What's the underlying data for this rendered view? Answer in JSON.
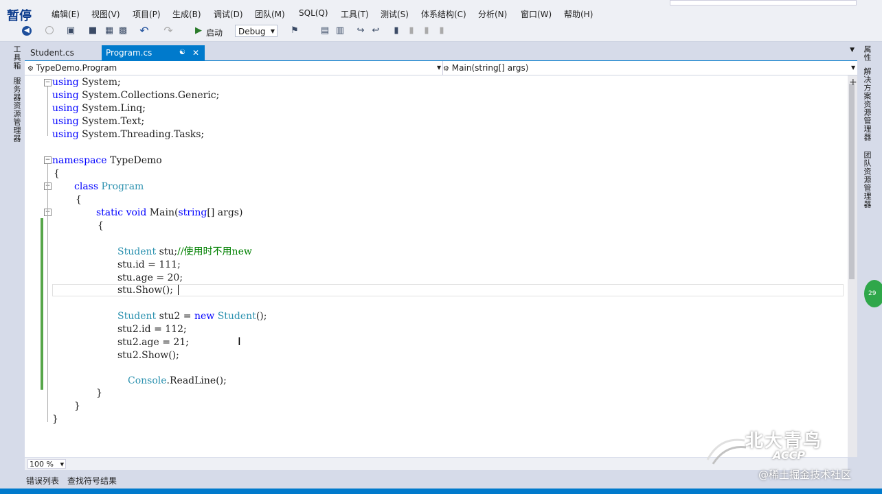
{
  "overlay": {
    "pause_text": "暂停"
  },
  "menu": [
    "编辑(E)",
    "视图(V)",
    "项目(P)",
    "生成(B)",
    "调试(D)",
    "团队(M)",
    "SQL(Q)",
    "工具(T)",
    "测试(S)",
    "体系结构(C)",
    "分析(N)",
    "窗口(W)",
    "帮助(H)"
  ],
  "toolbar": {
    "start_label": "启动",
    "config": "Debug"
  },
  "left_strip": {
    "toolbox": "工具箱",
    "server_explorer": "服务器资源管理器"
  },
  "right_strip": {
    "properties": "属性",
    "solution_explorer": "解决方案资源管理器",
    "team_explorer": "团队资源管理器"
  },
  "tabs": [
    {
      "label": "Student.cs"
    },
    {
      "label": "Program.cs"
    }
  ],
  "navbar": {
    "class_path": "TypeDemo.Program",
    "member": "Main(string[] args)"
  },
  "code": {
    "l1_kw": "using",
    "l1_rest": " System;",
    "l2_kw": "using",
    "l2_rest": " System.Collections.Generic;",
    "l3_kw": "using",
    "l3_rest": " System.Linq;",
    "l4_kw": "using",
    "l4_rest": " System.Text;",
    "l5_kw": "using",
    "l5_rest": " System.Threading.Tasks;",
    "l7_kw": "namespace",
    "l7_rest": " TypeDemo",
    "l8": "{",
    "l9_kw": "class",
    "l9_type": "Program",
    "l10": "{",
    "l11_kw1": "static",
    "l11_kw2": "void",
    "l11_name": "Main(",
    "l11_kw3": "string",
    "l11_rest": "[] args)",
    "l12": "{",
    "l14_type": "Student",
    "l14_var": " stu;",
    "l14_comment": "//使用时不用new",
    "l15": "stu.id = 111;",
    "l16": "stu.age = 20;",
    "l17": "stu.Show();",
    "l19_type": "Student",
    "l19_mid": " stu2 = ",
    "l19_kw": "new",
    "l19_type2": "Student",
    "l19_end": "();",
    "l20": "stu2.id = 112;",
    "l21": "stu2.age = 21;",
    "l22": "stu2.Show();",
    "l24_type": "Console",
    "l24_rest": ".ReadLine();",
    "l25": "}",
    "l26": "}",
    "l27": "}"
  },
  "zoom": "100 %",
  "panel_tabs": [
    "错误列表",
    "查找符号结果"
  ],
  "side_badge": "29",
  "watermark": {
    "logo_cn": "北大青鸟",
    "logo_en": "ACCP",
    "credit": "@稀土掘金技术社区"
  },
  "colors": {
    "accent": "#007acc",
    "keyword": "#0000ff",
    "type": "#2b91af",
    "comment": "#008000",
    "change_bar": "#57a64a"
  }
}
